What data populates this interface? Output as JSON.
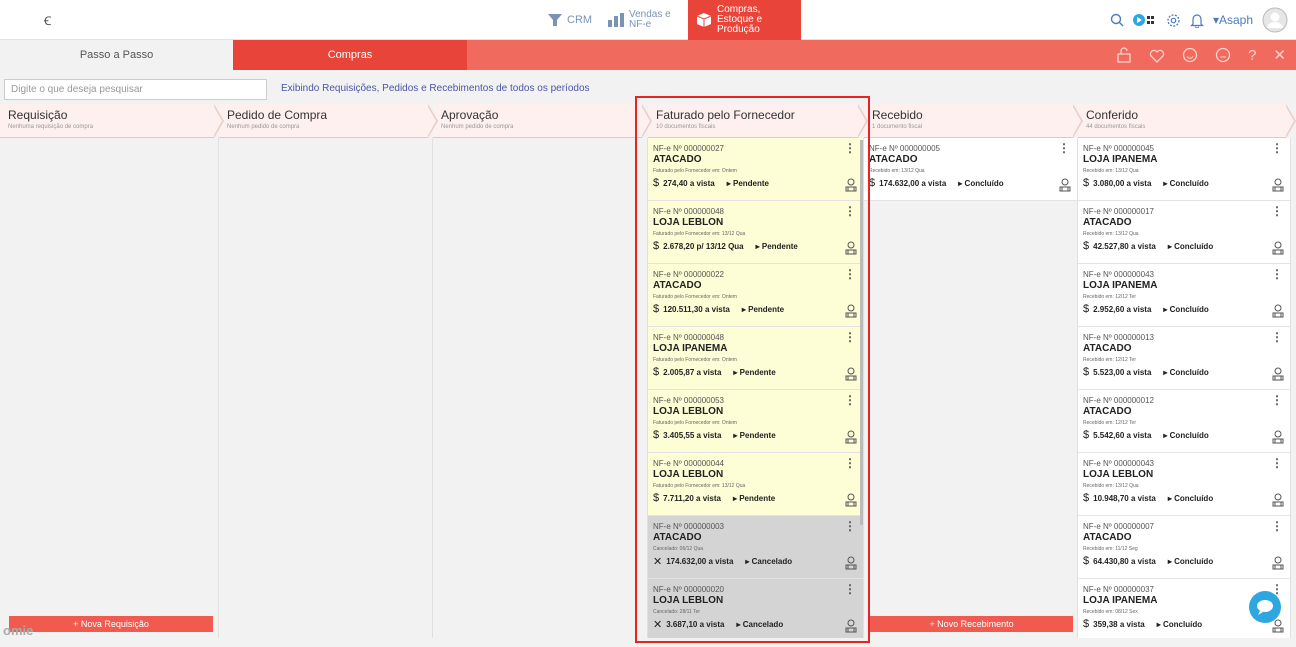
{
  "app": {
    "logo": "Ꞓ",
    "user_name": "Asaph",
    "brand_watermark": "omie"
  },
  "modules": {
    "crm": "CRM",
    "vendas": "Vendas e NF-e",
    "compras": "Compras, Estoque e Produção"
  },
  "tabs": {
    "passo": "Passo a Passo",
    "compras": "Compras"
  },
  "search": {
    "placeholder": "Digite o que deseja pesquisar",
    "period_text": "Exibindo Requisições, Pedidos e Recebimentos de todos os períodos"
  },
  "columns": [
    {
      "title": "Requisição",
      "subtitle": "Nenhuma requisição de compra"
    },
    {
      "title": "Pedido de Compra",
      "subtitle": "Nenhum pedido de compra"
    },
    {
      "title": "Aprovação",
      "subtitle": "Nenhum pedido de compra"
    },
    {
      "title": "Faturado pelo Fornecedor",
      "subtitle": "10 documentos fiscais"
    },
    {
      "title": "Recebido",
      "subtitle": "1 documento fiscal"
    },
    {
      "title": "Conferido",
      "subtitle": "44 documentos fiscais"
    }
  ],
  "faturado": [
    {
      "num": "NF-e Nº 000000027",
      "loja": "ATACADO",
      "date": "Faturado pelo Fornecedor em: Ontem",
      "amount": "274,40 a vista",
      "status": "Pendente",
      "state": "pendente"
    },
    {
      "num": "NF-e Nº 000000048",
      "loja": "LOJA LEBLON",
      "date": "Faturado pelo Fornecedor em: 13/12 Qua",
      "amount": "2.678,20 p/ 13/12 Qua",
      "status": "Pendente",
      "state": "pendente"
    },
    {
      "num": "NF-e Nº 000000022",
      "loja": "ATACADO",
      "date": "Faturado pelo Fornecedor em: Ontem",
      "amount": "120.511,30 a vista",
      "status": "Pendente",
      "state": "pendente"
    },
    {
      "num": "NF-e Nº 000000048",
      "loja": "LOJA IPANEMA",
      "date": "Faturado pelo Fornecedor em: Ontem",
      "amount": "2.005,87 a vista",
      "status": "Pendente",
      "state": "pendente"
    },
    {
      "num": "NF-e Nº 000000053",
      "loja": "LOJA LEBLON",
      "date": "Faturado pelo Fornecedor em: Ontem",
      "amount": "3.405,55 a vista",
      "status": "Pendente",
      "state": "pendente"
    },
    {
      "num": "NF-e Nº 000000044",
      "loja": "LOJA LEBLON",
      "date": "Faturado pelo Fornecedor em: 13/12 Qua",
      "amount": "7.711,20 a vista",
      "status": "Pendente",
      "state": "pendente"
    },
    {
      "num": "NF-e Nº 000000003",
      "loja": "ATACADO",
      "date": "Cancelado: 06/12 Qua",
      "amount": "174.632,00 a vista",
      "status": "Cancelado",
      "state": "cancelado"
    },
    {
      "num": "NF-e Nº 000000020",
      "loja": "LOJA LEBLON",
      "date": "Cancelado: 28/11 Ter",
      "amount": "3.687,10 a vista",
      "status": "Cancelado",
      "state": "cancelado"
    }
  ],
  "recebido": [
    {
      "num": "NF-e Nº 000000005",
      "loja": "ATACADO",
      "date": "Recebido em: 13/12 Qua",
      "amount": "174.632,00 a vista",
      "status": "Concluído"
    }
  ],
  "conferido": [
    {
      "num": "NF-e Nº 000000045",
      "loja": "LOJA IPANEMA",
      "date": "Recebido em: 13/12 Qua",
      "amount": "3.080,00 a vista",
      "status": "Concluído"
    },
    {
      "num": "NF-e Nº 000000017",
      "loja": "ATACADO",
      "date": "Recebido em: 13/12 Qua",
      "amount": "42.527,80 a vista",
      "status": "Concluído"
    },
    {
      "num": "NF-e Nº 000000043",
      "loja": "LOJA IPANEMA",
      "date": "Recebido em: 12/12 Ter",
      "amount": "2.952,60 a vista",
      "status": "Concluído"
    },
    {
      "num": "NF-e Nº 000000013",
      "loja": "ATACADO",
      "date": "Recebido em: 12/12 Ter",
      "amount": "5.523,00 a vista",
      "status": "Concluído"
    },
    {
      "num": "NF-e Nº 000000012",
      "loja": "ATACADO",
      "date": "Recebido em: 12/12 Ter",
      "amount": "5.542,60 a vista",
      "status": "Concluído"
    },
    {
      "num": "NF-e Nº 000000043",
      "loja": "LOJA LEBLON",
      "date": "Recebido em: 13/12 Qua",
      "amount": "10.948,70 a vista",
      "status": "Concluído"
    },
    {
      "num": "NF-e Nº 000000007",
      "loja": "ATACADO",
      "date": "Recebido em: 11/12 Seg",
      "amount": "64.430,80 a vista",
      "status": "Concluído"
    },
    {
      "num": "NF-e Nº 000000037",
      "loja": "LOJA IPANEMA",
      "date": "Recebido em: 08/12 Sex",
      "amount": "359,38 a vista",
      "status": "Concluído"
    }
  ],
  "buttons": {
    "nova_requisicao": "+ Nova Requisição",
    "novo_recebimento": "+ Novo Recebimento"
  },
  "colors": {
    "accent": "#e8443a",
    "pending_card": "#fdfdd6",
    "cancelled_card": "#d4d4d4",
    "highlight_border": "#e52424"
  }
}
